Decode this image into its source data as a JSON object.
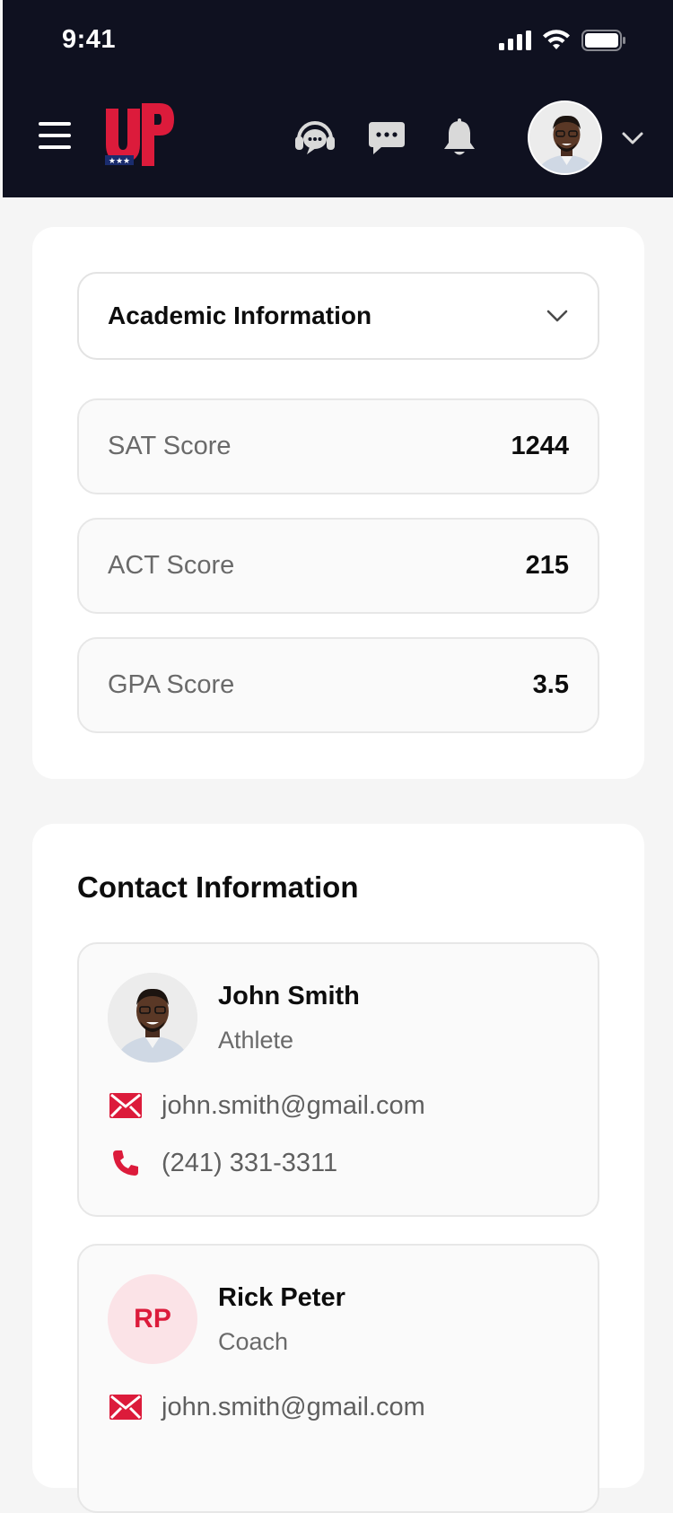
{
  "status_bar": {
    "time": "9:41"
  },
  "header": {
    "logo_text": "UP",
    "brand_color": "#dc1b3b",
    "icons": [
      "menu-icon",
      "support-headset-icon",
      "chat-icon",
      "bell-icon",
      "profile-avatar",
      "chevron-down-icon"
    ]
  },
  "academic": {
    "dropdown_label": "Academic Information",
    "scores": [
      {
        "label": "SAT Score",
        "value": "1244"
      },
      {
        "label": "ACT Score",
        "value": "215"
      },
      {
        "label": "GPA Score",
        "value": "3.5"
      }
    ]
  },
  "contact": {
    "title": "Contact Information",
    "people": [
      {
        "name": "John Smith",
        "role": "Athlete",
        "email": "john.smith@gmail.com",
        "phone": "(241) 331-3311",
        "avatar": "photo"
      },
      {
        "name": "Rick Peter",
        "role": "Coach",
        "initials": "RP",
        "email": "john.smith@gmail.com"
      }
    ]
  }
}
